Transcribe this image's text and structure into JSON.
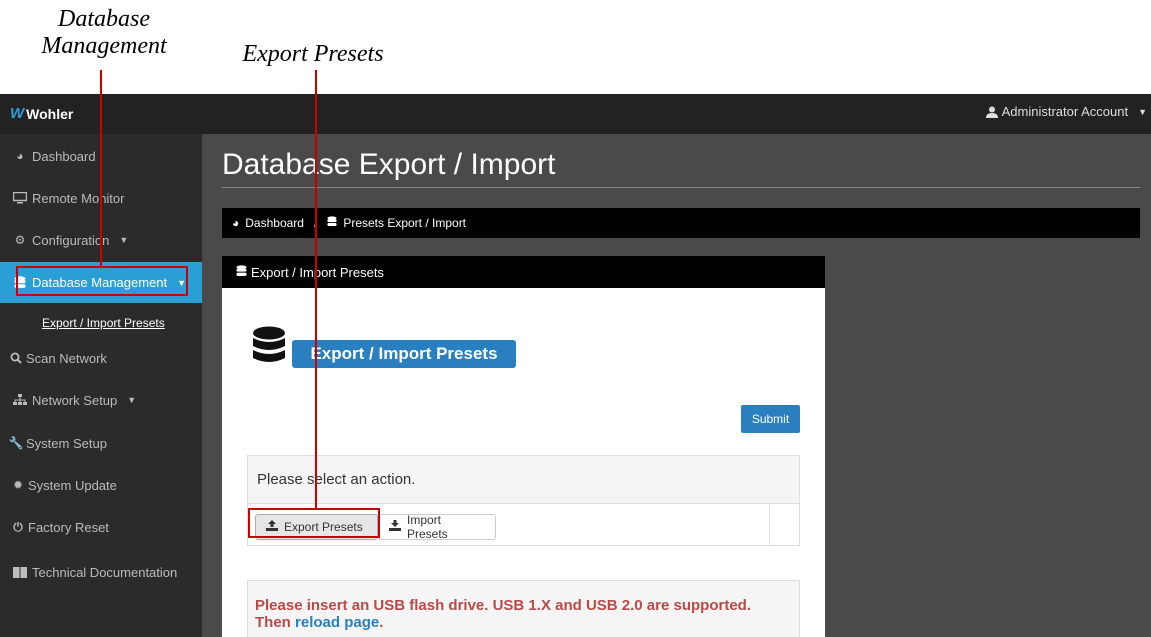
{
  "annotations": {
    "database_management": "Database Management",
    "export_presets": "Export Presets"
  },
  "topbar": {
    "brand": "Wohler",
    "user_menu": "Administrator Account"
  },
  "sidebar": {
    "items": [
      {
        "label": "Dashboard",
        "icon": "dashboard-icon"
      },
      {
        "label": "Remote Monitor",
        "icon": "monitor-icon"
      },
      {
        "label": "Configuration",
        "icon": "cogs-icon",
        "has_caret": true
      },
      {
        "label": "Database Management",
        "icon": "database-icon",
        "has_caret": true,
        "active": true
      },
      {
        "label": "Scan Network",
        "icon": "search-icon"
      },
      {
        "label": "Network Setup",
        "icon": "sitemap-icon",
        "has_caret": true
      },
      {
        "label": "System Setup",
        "icon": "wrench-icon"
      },
      {
        "label": "System Update",
        "icon": "gear-icon"
      },
      {
        "label": "Factory Reset",
        "icon": "power-icon"
      },
      {
        "label": "Technical Documentation",
        "icon": "book-icon"
      }
    ],
    "subitem": "Export / Import Presets"
  },
  "main": {
    "title": "Database Export / Import",
    "breadcrumb": {
      "home": "Dashboard",
      "separator": "/",
      "current": "Presets Export / Import"
    },
    "panel": {
      "heading": "Export / Import Presets",
      "pill": "Export / Import Presets",
      "submit": "Submit",
      "action_prompt": "Please select an action.",
      "export_button": "Export Presets",
      "import_button": "Import Presets",
      "warning": "Please insert an USB flash drive. USB 1.X and USB 2.0 are supported.",
      "warning_then": "Then",
      "warning_link": "reload page",
      "warning_end": "."
    }
  },
  "colors": {
    "accent": "#2a9fd6",
    "primary_button": "#2a7fc1",
    "warning": "#b94a48",
    "callout": "#cc0000"
  }
}
